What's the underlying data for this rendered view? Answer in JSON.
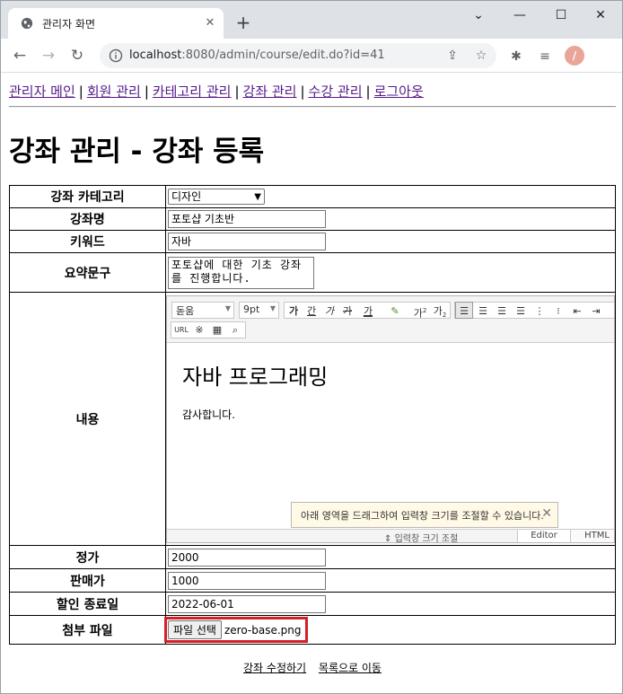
{
  "browser": {
    "tab_title": "관리자 화면",
    "url_host": "localhost",
    "url_rest": ":8080/admin/course/edit.do?id=41",
    "avatar_letter": "/"
  },
  "nav": {
    "items": [
      "관리자 메인",
      "회원 관리",
      "카테고리 관리",
      "강좌 관리",
      "수강 관리",
      "로그아웃"
    ],
    "separator": "|"
  },
  "page_title": "강좌 관리 - 강좌 등록",
  "form": {
    "category_label": "강좌 카테고리",
    "category_value": "디자인",
    "name_label": "강좌명",
    "name_value": "포토샵 기초반",
    "keyword_label": "키워드",
    "keyword_value": "자바",
    "summary_label": "요약문구",
    "summary_value": "포토샵에 대한 기초 강좌를 진행합니다.",
    "content_label": "내용",
    "price_label": "정가",
    "price_value": "2000",
    "sale_price_label": "판매가",
    "sale_price_value": "1000",
    "sale_end_label": "할인 종료일",
    "sale_end_value": "2022-06-01",
    "file_label": "첨부 파일",
    "file_button": "파일 선택",
    "file_name": "zero-base.png"
  },
  "editor": {
    "font_name": "돋움",
    "font_size": "9pt",
    "btn_bold": "가",
    "btn_underline": "간",
    "btn_italic": "가",
    "btn_strike": "가",
    "btn_fontcolor": "가",
    "btn_sup": "가",
    "btn_sub": "가",
    "btn_url": "URL",
    "heading": "자바 프로그래밍",
    "paragraph": "감사합니다.",
    "tip_text": "아래 영역을 드래그하여 입력창 크기를 조절할 수 있습니다.",
    "resize_label": "입력창 크기 조절",
    "tab_editor": "Editor",
    "tab_html": "HTML"
  },
  "actions": {
    "submit": "강좌 수정하기",
    "list": "목록으로 이동"
  }
}
